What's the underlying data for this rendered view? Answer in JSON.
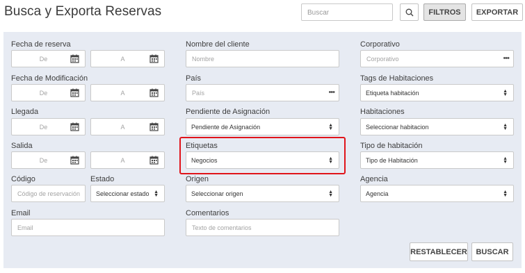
{
  "header": {
    "title": "Busca y Exporta Reservas",
    "search_placeholder": "Buscar",
    "filtros_label": "FILTROS",
    "exportar_label": "EXPORTAR"
  },
  "filters": {
    "fecha_reserva": {
      "label": "Fecha de reserva",
      "from_placeholder": "De",
      "to_placeholder": "A"
    },
    "fecha_modificacion": {
      "label": "Fecha de Modificación",
      "from_placeholder": "De",
      "to_placeholder": "A"
    },
    "llegada": {
      "label": "Llegada",
      "from_placeholder": "De",
      "to_placeholder": "A"
    },
    "salida": {
      "label": "Salida",
      "from_placeholder": "De",
      "to_placeholder": "A"
    },
    "codigo": {
      "label": "Código",
      "placeholder": "Código de reservación"
    },
    "estado": {
      "label": "Estado",
      "value": "Seleccionar estado"
    },
    "email": {
      "label": "Email",
      "placeholder": "Email"
    },
    "nombre_cliente": {
      "label": "Nombre del cliente",
      "placeholder": "Nombre"
    },
    "pais": {
      "label": "País",
      "placeholder": "País"
    },
    "pendiente_asignacion": {
      "label": "Pendiente de Asignación",
      "value": "Pendiente de Asignación"
    },
    "etiquetas": {
      "label": "Etiquetas",
      "value": "Negocios"
    },
    "origen": {
      "label": "Origen",
      "value": "Seleccionar origen"
    },
    "comentarios": {
      "label": "Comentarios",
      "placeholder": "Texto de comentarios"
    },
    "corporativo": {
      "label": "Corporativo",
      "placeholder": "Corporativo"
    },
    "tags_habitaciones": {
      "label": "Tags de Habitaciones",
      "value": "Etiqueta habitación"
    },
    "habitaciones": {
      "label": "Habitaciones",
      "value": "Seleccionar habitacion"
    },
    "tipo_habitacion": {
      "label": "Tipo de habitación",
      "value": "Tipo de Habitación"
    },
    "agencia": {
      "label": "Agencia",
      "value": "Agencia"
    }
  },
  "actions": {
    "restablecer_label": "RESTABLECER",
    "buscar_label": "BUSCAR"
  },
  "colors": {
    "panel_bg": "#e7ebf3",
    "highlight": "#e0141a"
  },
  "icons": {
    "search": "magnifier",
    "calendar": "calendar",
    "more": "ellipsis",
    "select": "up-down-chevrons"
  }
}
